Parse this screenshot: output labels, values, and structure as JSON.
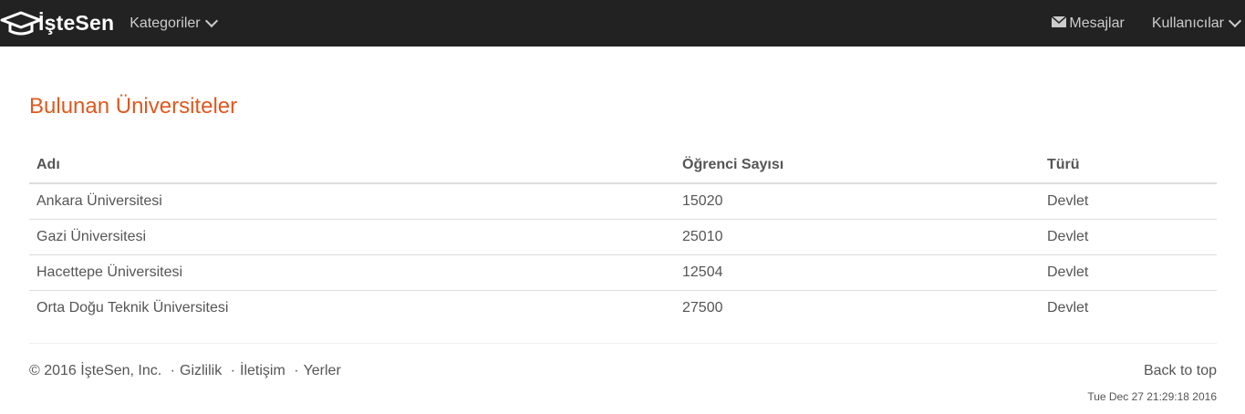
{
  "navbar": {
    "brand": "İşteSen",
    "categories_label": "Kategoriler",
    "messages_label": "Mesajlar",
    "users_label": "Kullanıcılar"
  },
  "main": {
    "title": "Bulunan Üniversiteler",
    "table": {
      "headers": [
        "Adı",
        "Öğrenci Sayısı",
        "Türü"
      ],
      "rows": [
        [
          "Ankara Üniversitesi",
          "15020",
          "Devlet"
        ],
        [
          "Gazi Üniversitesi",
          "25010",
          "Devlet"
        ],
        [
          "Hacettepe Üniversitesi",
          "12504",
          "Devlet"
        ],
        [
          "Orta Doğu Teknik Üniversitesi",
          "27500",
          "Devlet"
        ]
      ]
    }
  },
  "footer": {
    "copyright": "© 2016 İşteSen, Inc.",
    "links": [
      "Gizlilik",
      "İletişim",
      "Yerler"
    ],
    "separator": "·",
    "back_to_top": "Back to top",
    "timestamp": "Tue Dec 27 21:29:18 2016"
  },
  "colors": {
    "navbar_bg": "#222222",
    "title_accent": "#e0581f"
  },
  "icons": {
    "brand": "graduation-cap-icon",
    "dropdown": "chevron-down-icon",
    "messages": "envelope-icon"
  }
}
